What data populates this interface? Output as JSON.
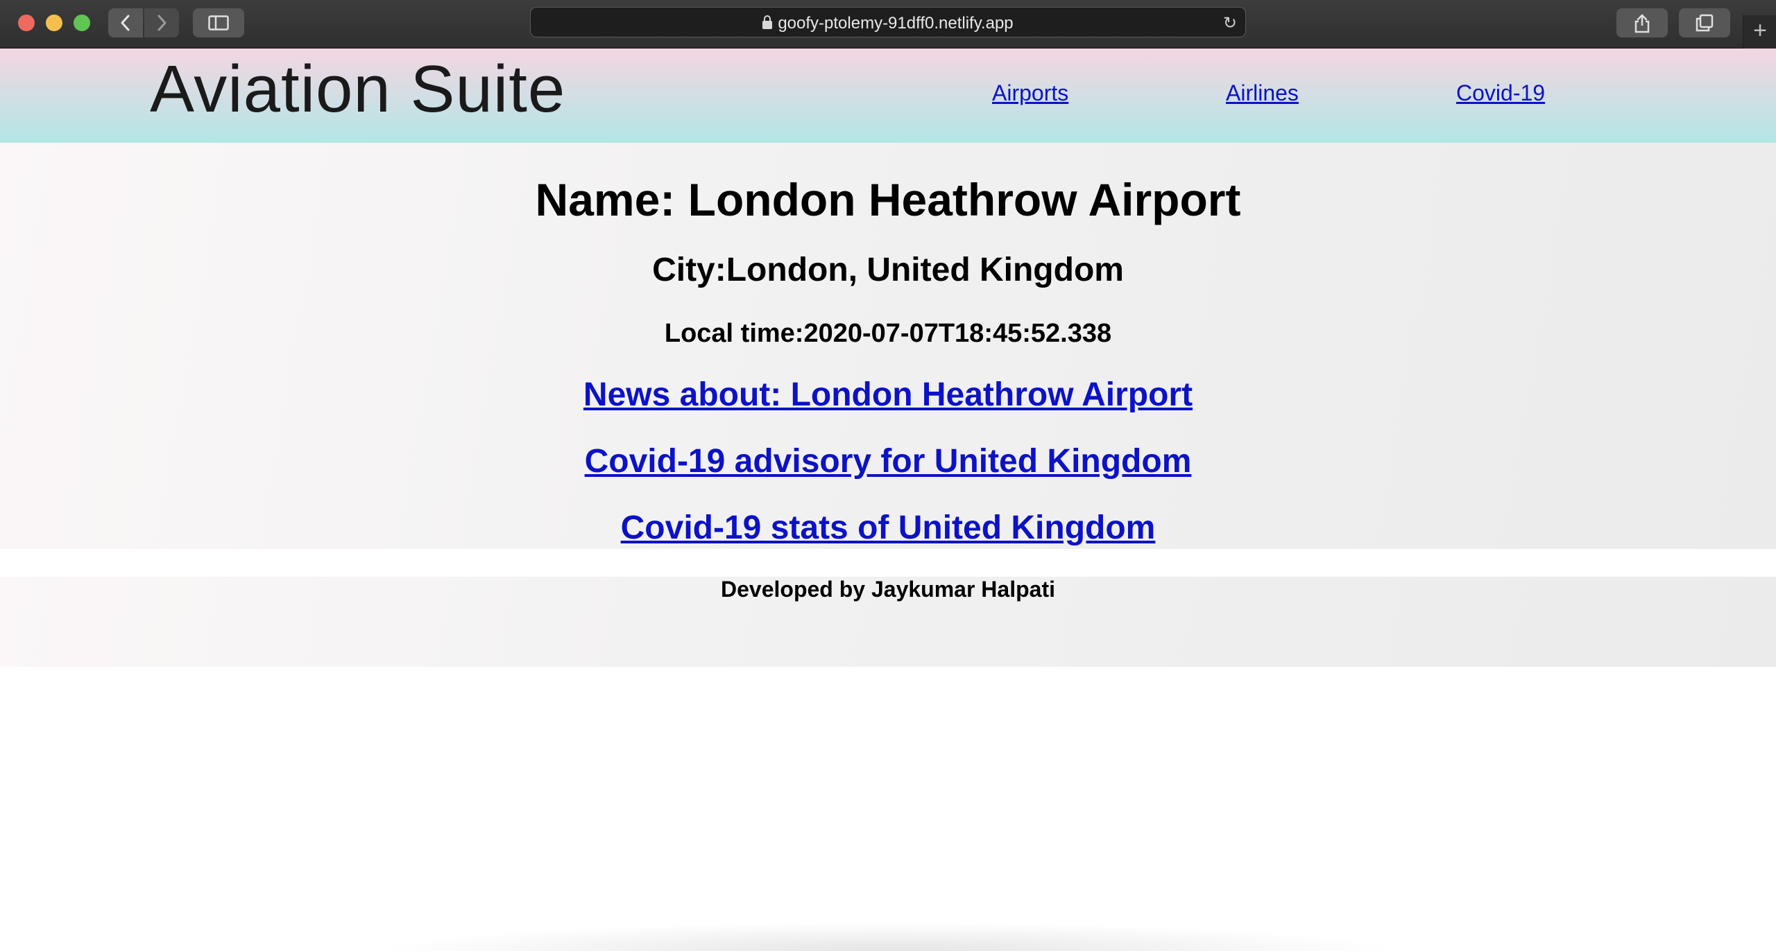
{
  "browser": {
    "url": "goofy-ptolemy-91dff0.netlify.app",
    "icons": {
      "back": "chevron-left-icon",
      "forward": "chevron-right-icon",
      "sidebar": "sidebar-icon",
      "lock": "lock-icon",
      "reload": "reload-icon",
      "share": "share-icon",
      "tabs": "tabs-overview-icon",
      "new_tab": "plus-icon"
    }
  },
  "header": {
    "brand": "Aviation Suite",
    "nav": [
      {
        "label": "Airports"
      },
      {
        "label": "Airlines"
      },
      {
        "label": "Covid-19"
      }
    ],
    "gradient_colors": [
      "#f3d6e2",
      "#b3e6e5"
    ]
  },
  "airport": {
    "name": "Name: London Heathrow Airport",
    "city": "City:London, United Kingdom",
    "local_time": "Local time:2020-07-07T18:45:52.338"
  },
  "links": {
    "news": "News about: London Heathrow Airport",
    "advisory": "Covid-19 advisory for United Kingdom",
    "stats": "Covid-19 stats of United Kingdom"
  },
  "footer": {
    "text": "Developed by Jaykumar Halpati"
  },
  "colors": {
    "link": "#0c12c6"
  }
}
